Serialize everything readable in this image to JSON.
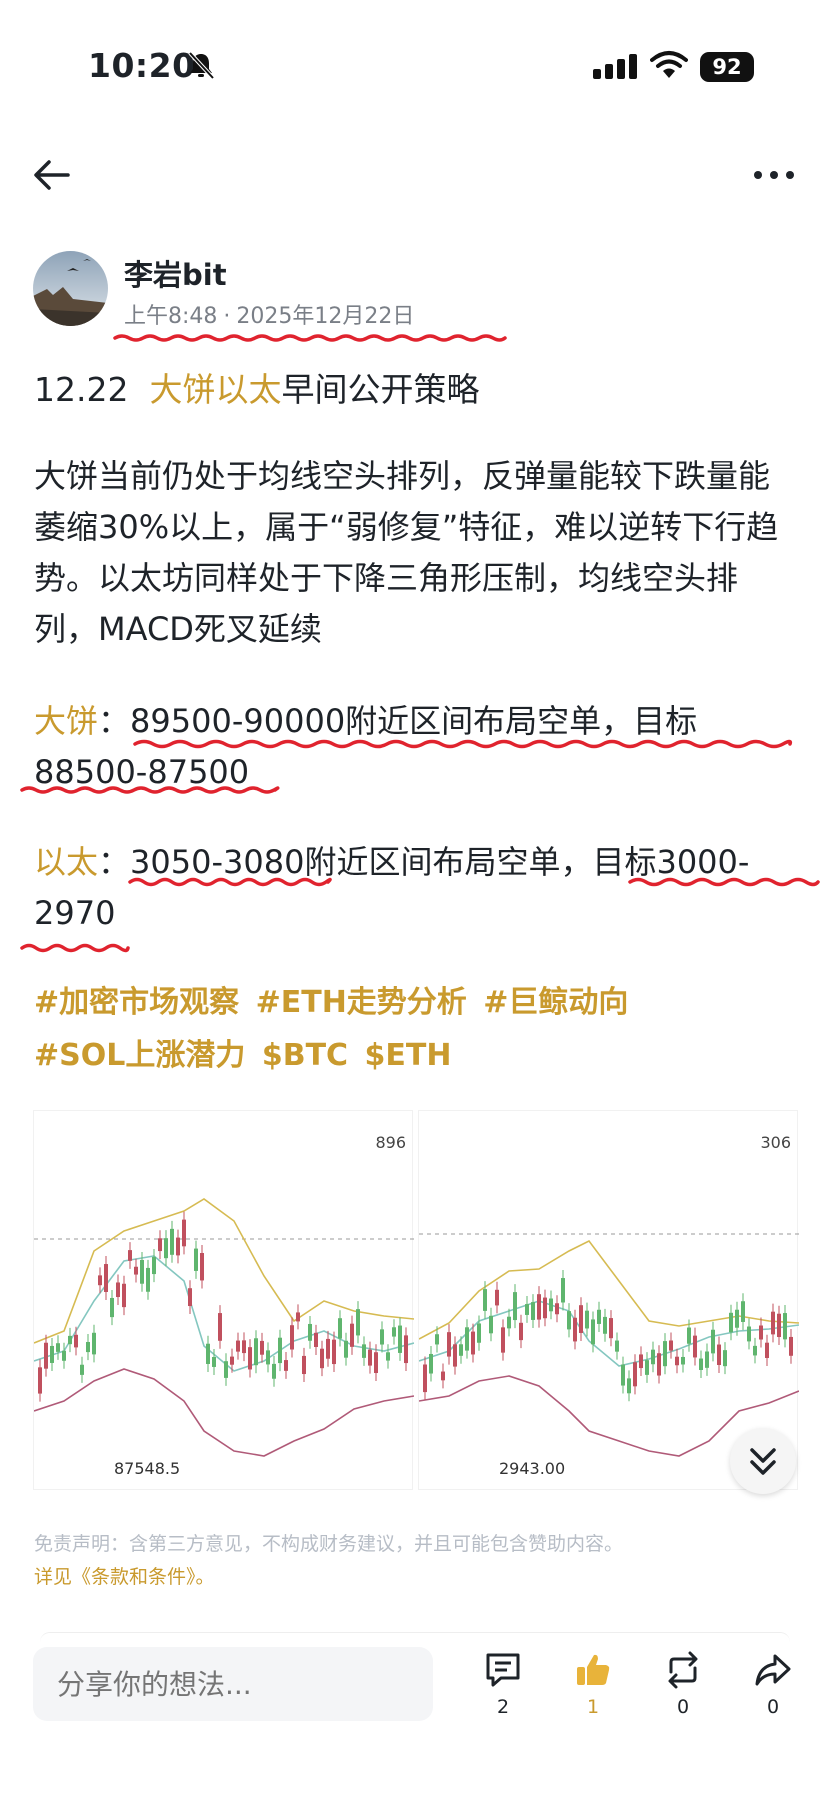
{
  "status_bar": {
    "time": "10:20",
    "battery": "92"
  },
  "post": {
    "author": "李岩bit",
    "time": "上午8:48",
    "date": "2025年12月22日",
    "headline": {
      "prefix": "12.22",
      "highlight": "大饼以太",
      "suffix": "早间公开策略"
    },
    "body": "大饼当前仍处于均线空头排列，反弹量能较下跌量能萎缩30%以上，属于“弱修复”特征，难以逆转下行趋势。以太坊同样处于下降三角形压制，均线空头排列，MACD死叉延续",
    "btc_strategy": {
      "label": "大饼",
      "sep": "：",
      "text": "89500-90000附近区间布局空单，目标88500-87500"
    },
    "eth_strategy": {
      "label": "以太",
      "sep": "：",
      "text": "3050-3080附近区间布局空单，目标3000-2970"
    },
    "tags": [
      "#加密市场观察",
      "#ETH走势分析",
      "#巨鲸动向",
      "#SOL上涨潜力",
      "$BTC",
      "$ETH"
    ]
  },
  "charts": {
    "btc": {
      "top_price": "896",
      "low_price": "87548.5"
    },
    "eth": {
      "top_price": "306",
      "low_price": "2943.00"
    }
  },
  "disclaimer": {
    "text": "免责声明：含第三方意见，不构成财务建议，并且可能包含赞助内容。",
    "link": "详见《条款和条件》。"
  },
  "bottom_bar": {
    "placeholder": "分享你的想法...",
    "comments": "2",
    "likes": "1",
    "reposts": "0",
    "shares": "0"
  },
  "colors": {
    "accent": "#c99a2e",
    "up": "#5fb56e",
    "down": "#c0505e",
    "underline": "#e0232e"
  }
}
